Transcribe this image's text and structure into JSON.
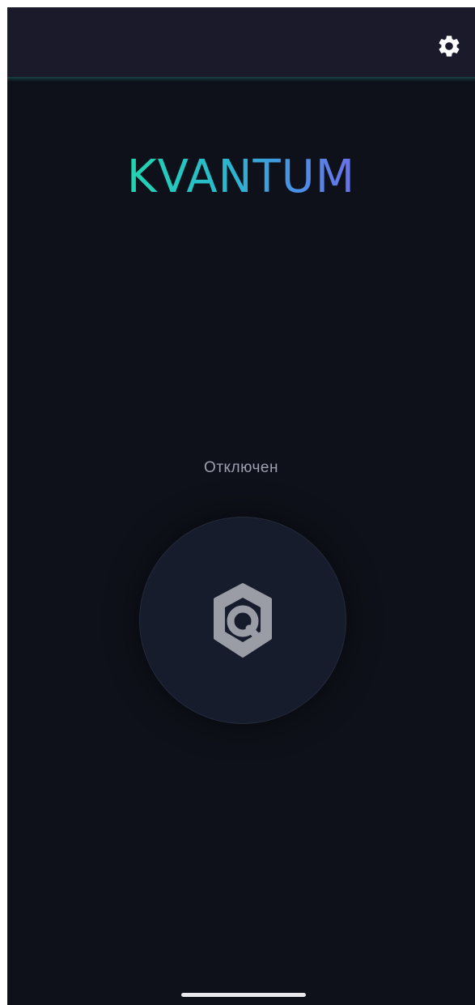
{
  "app": {
    "title": "KVANTUM"
  },
  "header": {
    "settings_icon": "gear-icon"
  },
  "main": {
    "status_text": "Отключен",
    "connect_icon": "shield-q-icon"
  },
  "colors": {
    "background": "#0f111a",
    "header": "#1a1a2b",
    "brand_gradient_start": "#1fd6b0",
    "brand_gradient_end": "#6c6fe8",
    "status_text": "#9aa0ad",
    "button_fill": "#171c2c",
    "icon": "#9a9ca6"
  }
}
